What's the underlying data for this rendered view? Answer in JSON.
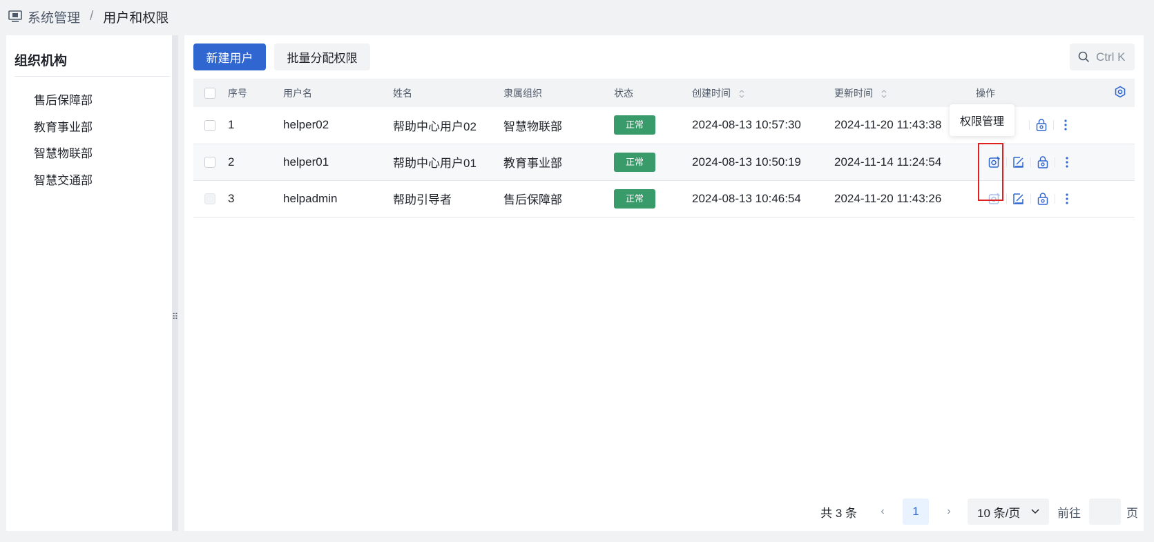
{
  "breadcrumb": {
    "root": "系统管理",
    "separator": "/",
    "current": "用户和权限"
  },
  "sidebar": {
    "title": "组织机构",
    "items": [
      {
        "label": "售后保障部"
      },
      {
        "label": "教育事业部"
      },
      {
        "label": "智慧物联部"
      },
      {
        "label": "智慧交通部"
      }
    ]
  },
  "toolbar": {
    "new_user_label": "新建用户",
    "batch_assign_label": "批量分配权限",
    "search_label": "Ctrl K"
  },
  "table": {
    "headers": {
      "index": "序号",
      "username": "用户名",
      "name": "姓名",
      "org": "隶属组织",
      "status": "状态",
      "created": "创建时间",
      "updated": "更新时间",
      "actions": "操作"
    },
    "rows": [
      {
        "index": "1",
        "username": "helper02",
        "name": "帮助中心用户02",
        "org": "智慧物联部",
        "status": "正常",
        "created": "2024-08-13 10:57:30",
        "updated": "2024-11-20 11:43:38"
      },
      {
        "index": "2",
        "username": "helper01",
        "name": "帮助中心用户01",
        "org": "教育事业部",
        "status": "正常",
        "created": "2024-08-13 10:50:19",
        "updated": "2024-11-14 11:24:54"
      },
      {
        "index": "3",
        "username": "helpadmin",
        "name": "帮助引导者",
        "org": "售后保障部",
        "status": "正常",
        "created": "2024-08-13 10:46:54",
        "updated": "2024-11-20 11:43:26"
      }
    ]
  },
  "tooltip": {
    "text": "权限管理"
  },
  "pagination": {
    "total": "共 3 条",
    "current_page": "1",
    "page_size": "10 条/页",
    "goto_label": "前往",
    "goto_unit": "页"
  },
  "colors": {
    "primary": "#2f66d0",
    "status_normal": "#3a9b6a",
    "highlight": "#e02020"
  }
}
